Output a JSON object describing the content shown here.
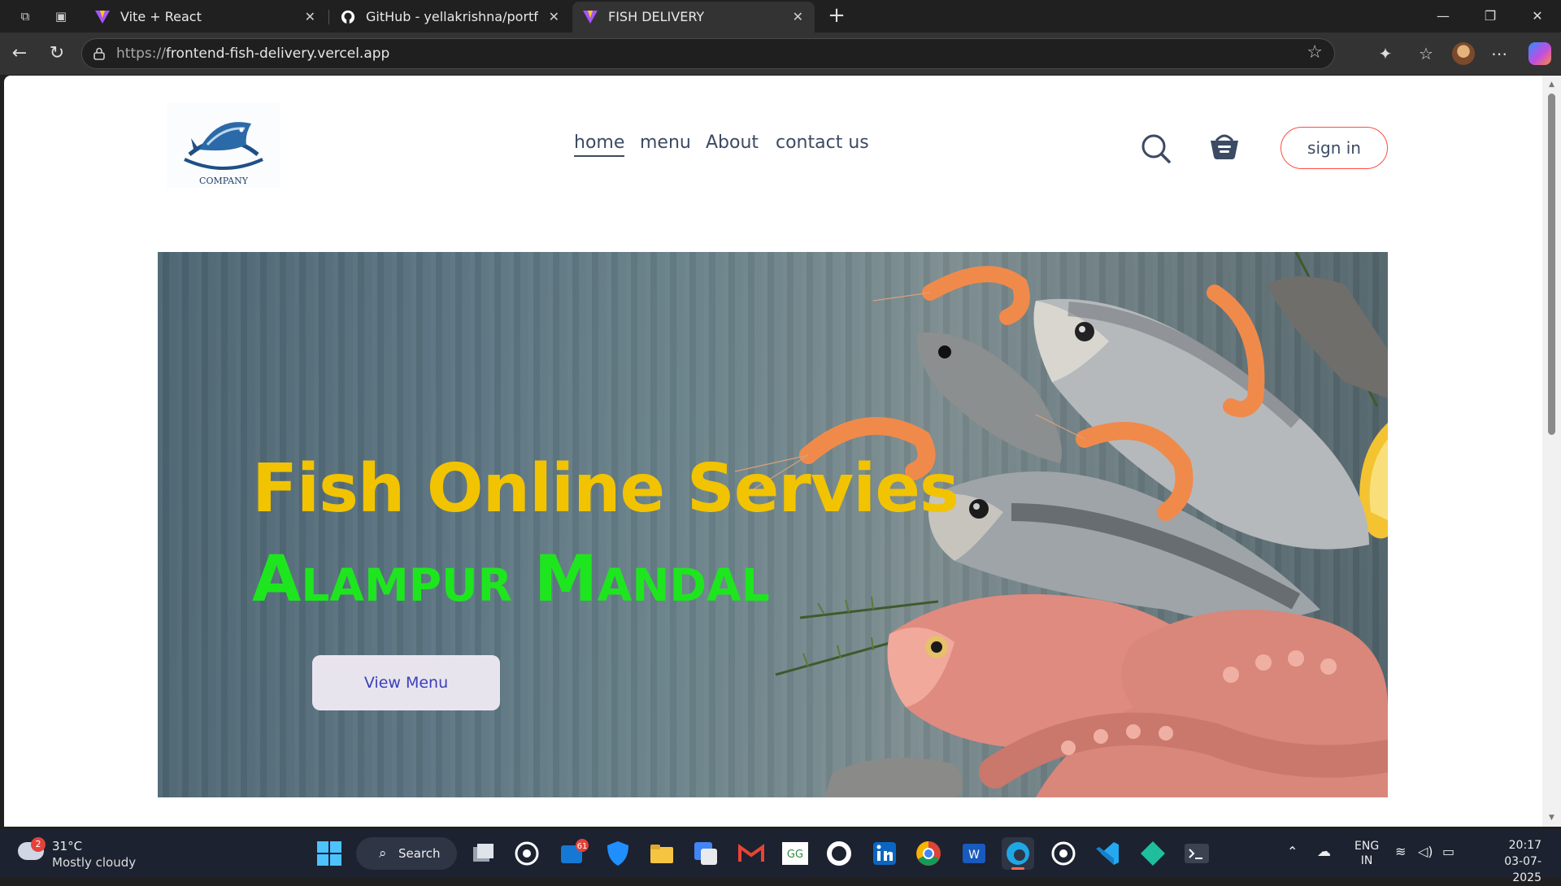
{
  "browser": {
    "tabs": [
      {
        "label": "Vite + React",
        "active": false
      },
      {
        "label": "GitHub - yellakrishna/portfolio",
        "active": false
      },
      {
        "label": "FISH DELIVERY",
        "active": true
      }
    ],
    "url_protocol": "https://",
    "url_host": "frontend-fish-delivery.vercel.app"
  },
  "site": {
    "logo_text": "COMPANY",
    "nav": [
      {
        "label": "home",
        "active": true
      },
      {
        "label": "menu",
        "active": false
      },
      {
        "label": "About",
        "active": false
      },
      {
        "label": "contact us",
        "active": false
      }
    ],
    "signin_label": "sign in",
    "hero": {
      "title": "Fish Online Servies",
      "subtitle": "Alampur Mandal",
      "button_label": "View Menu"
    },
    "colors": {
      "title": "#f2c300",
      "subtitle": "#1ee61e",
      "signin_border": "#ff4b3e",
      "button_text": "#3a3fb8"
    }
  },
  "taskbar": {
    "weather_temp": "31°C",
    "weather_cond": "Mostly cloudy",
    "weather_badge": "2",
    "search_label": "Search",
    "mail_badge": "61",
    "lang_top": "ENG",
    "lang_bottom": "IN",
    "time": "20:17",
    "date": "03-07-2025"
  }
}
